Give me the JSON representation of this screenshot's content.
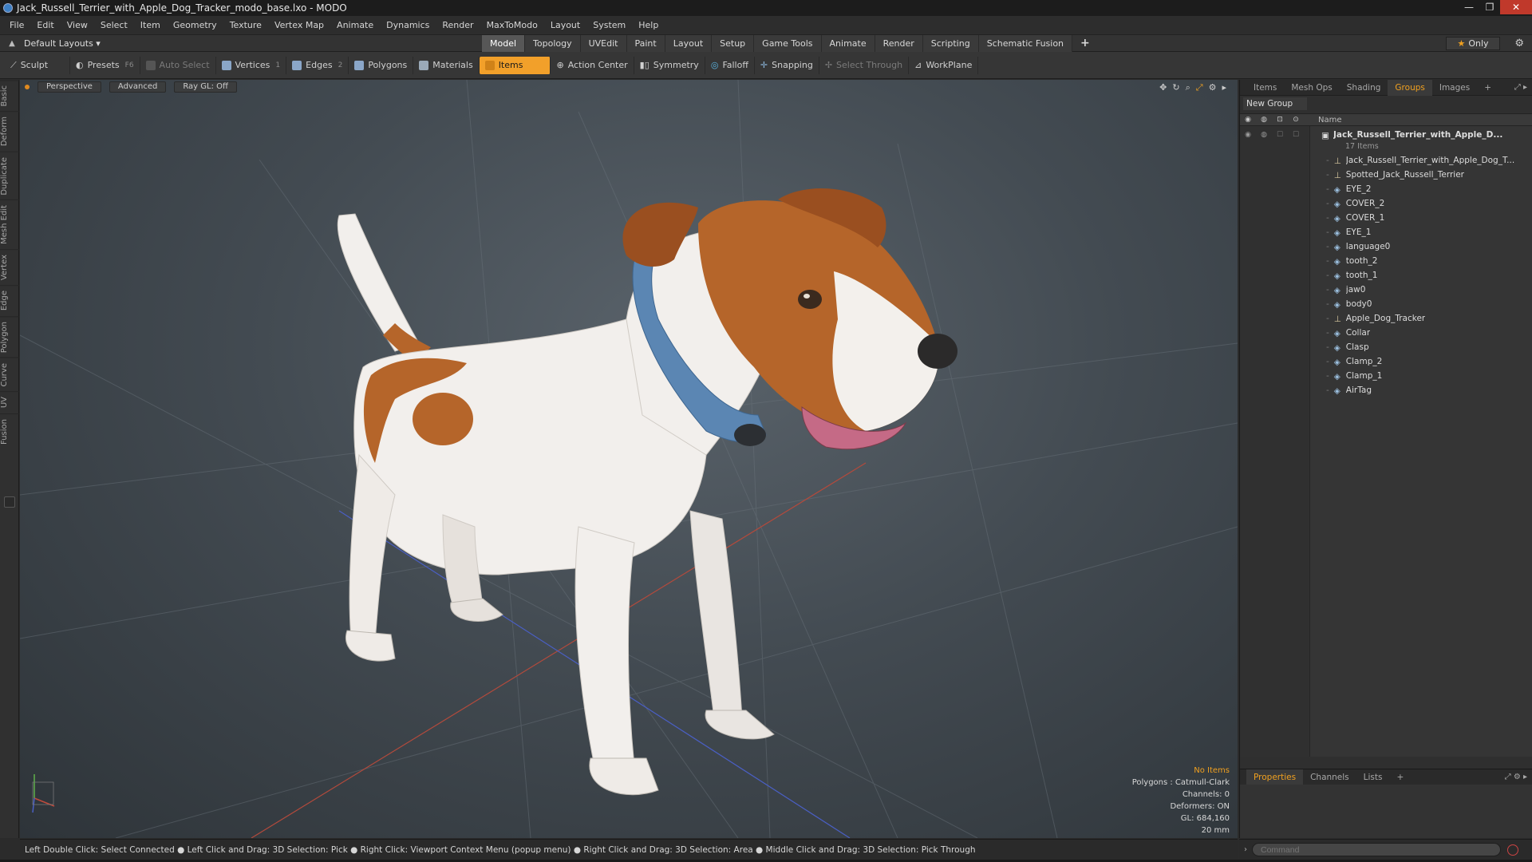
{
  "window": {
    "title": "Jack_Russell_Terrier_with_Apple_Dog_Tracker_modo_base.lxo - MODO",
    "controls": [
      "—",
      "❐",
      "✕"
    ]
  },
  "menu": [
    "File",
    "Edit",
    "View",
    "Select",
    "Item",
    "Geometry",
    "Texture",
    "Vertex Map",
    "Animate",
    "Dynamics",
    "Render",
    "MaxToModo",
    "Layout",
    "System",
    "Help"
  ],
  "layoutbar": {
    "layouts_label": "Default Layouts ▾",
    "tabs": [
      "Model",
      "Topology",
      "UVEdit",
      "Paint",
      "Layout",
      "Setup",
      "Game Tools",
      "Animate",
      "Render",
      "Scripting",
      "Schematic Fusion"
    ],
    "active_tab": "Model",
    "add_tab": "+",
    "only_label": "Only"
  },
  "toolbar": {
    "sculpt": "Sculpt",
    "presets": "Presets",
    "presets_key": "F6",
    "auto_select": "Auto Select",
    "vertices": "Vertices",
    "vertices_key": "1",
    "edges": "Edges",
    "edges_key": "2",
    "polygons": "Polygons",
    "materials": "Materials",
    "items": "Items",
    "action_center": "Action Center",
    "symmetry": "Symmetry",
    "falloff": "Falloff",
    "snapping": "Snapping",
    "select_through": "Select Through",
    "workplane": "WorkPlane"
  },
  "left_tabs": [
    "Basic",
    "Deform",
    "Duplicate",
    "Mesh Edit",
    "Vertex",
    "Edge",
    "Polygon",
    "Curve",
    "UV",
    "Fusion"
  ],
  "viewport": {
    "view": "Perspective",
    "shading": "Advanced",
    "raygl": "Ray GL: Off",
    "info": {
      "selection": "No Items",
      "polygons": "Polygons : Catmull-Clark",
      "channels": "Channels: 0",
      "deformers": "Deformers: ON",
      "gl": "GL: 684,160",
      "scale": "20 mm"
    }
  },
  "right_panel": {
    "tabs": [
      "Items",
      "Mesh Ops",
      "Shading",
      "Groups",
      "Images",
      "+"
    ],
    "active_tab": "Groups",
    "new_group": "New Group",
    "column_name": "Name",
    "root": "Jack_Russell_Terrier_with_Apple_D...",
    "root_count": "17 Items",
    "items": [
      {
        "name": "Jack_Russell_Terrier_with_Apple_Dog_T...",
        "type": "locator"
      },
      {
        "name": "Spotted_Jack_Russell_Terrier",
        "type": "locator"
      },
      {
        "name": "EYE_2",
        "type": "mesh"
      },
      {
        "name": "COVER_2",
        "type": "mesh"
      },
      {
        "name": "COVER_1",
        "type": "mesh"
      },
      {
        "name": "EYE_1",
        "type": "mesh"
      },
      {
        "name": "language0",
        "type": "mesh"
      },
      {
        "name": "tooth_2",
        "type": "mesh"
      },
      {
        "name": "tooth_1",
        "type": "mesh"
      },
      {
        "name": "jaw0",
        "type": "mesh"
      },
      {
        "name": "body0",
        "type": "mesh"
      },
      {
        "name": "Apple_Dog_Tracker",
        "type": "locator"
      },
      {
        "name": "Collar",
        "type": "mesh"
      },
      {
        "name": "Clasp",
        "type": "mesh"
      },
      {
        "name": "Clamp_2",
        "type": "mesh"
      },
      {
        "name": "Clamp_1",
        "type": "mesh"
      },
      {
        "name": "AirTag",
        "type": "mesh"
      }
    ],
    "bottom_tabs": [
      "Properties",
      "Channels",
      "Lists",
      "+"
    ],
    "bottom_active": "Properties"
  },
  "statusbar": {
    "text": "Left Double Click: Select Connected ● Left Click and Drag: 3D Selection: Pick ● Right Click: Viewport Context Menu (popup menu) ● Right Click and Drag: 3D Selection: Area ● Middle Click and Drag: 3D Selection: Pick Through"
  },
  "command": {
    "placeholder": "Command"
  },
  "colors": {
    "accent": "#f0a020",
    "viewport_bg": "#434b52",
    "dog_brown": "#b5652a",
    "collar_blue": "#5b86b3"
  }
}
